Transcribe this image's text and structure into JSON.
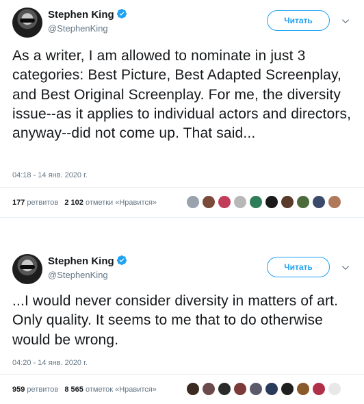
{
  "tweets": [
    {
      "author_name": "Stephen King",
      "handle": "@StephenKing",
      "follow_label": "Читать",
      "text": "As a writer, I am allowed to nominate in just 3 categories: Best Picture, Best Adapted Screenplay, and Best Original Screenplay. For me, the diversity issue--as it applies to individual actors and directors, anyway--did not come up. That said...",
      "timestamp": "04:18 - 14 янв. 2020 г.",
      "retweets_count": "177",
      "retweets_label": "ретвитов",
      "likes_count": "2 102",
      "likes_label": "отметки «Нравится»",
      "liker_colors": [
        "#9aa3ad",
        "#7a4a3a",
        "#c23d5a",
        "#b8b8b8",
        "#2e7d5b",
        "#1a1a1a",
        "#5a3a2a",
        "#4d6b3a",
        "#3a4a6a",
        "#b07a5a"
      ]
    },
    {
      "author_name": "Stephen King",
      "handle": "@StephenKing",
      "follow_label": "Читать",
      "text": "...I would never consider diversity in matters of art. Only quality. It seems to me that to do otherwise would be wrong.",
      "timestamp": "04:20 - 14 янв. 2020 г.",
      "retweets_count": "959",
      "retweets_label": "ретвитов",
      "likes_count": "8 565",
      "likes_label": "отметок «Нравится»",
      "liker_colors": [
        "#3a2a22",
        "#6a4a4a",
        "#2a2a2a",
        "#7a3a3a",
        "#5a5a6a",
        "#2a3a5a",
        "#1f1f1f",
        "#8a5a2a",
        "#b0304a",
        "#e8e8e8"
      ]
    }
  ],
  "colors": {
    "accent": "#1da1f2",
    "muted": "#657786",
    "text": "#14171a"
  },
  "icons": {
    "verified": "verified-badge-icon",
    "chevron": "chevron-down-icon"
  }
}
